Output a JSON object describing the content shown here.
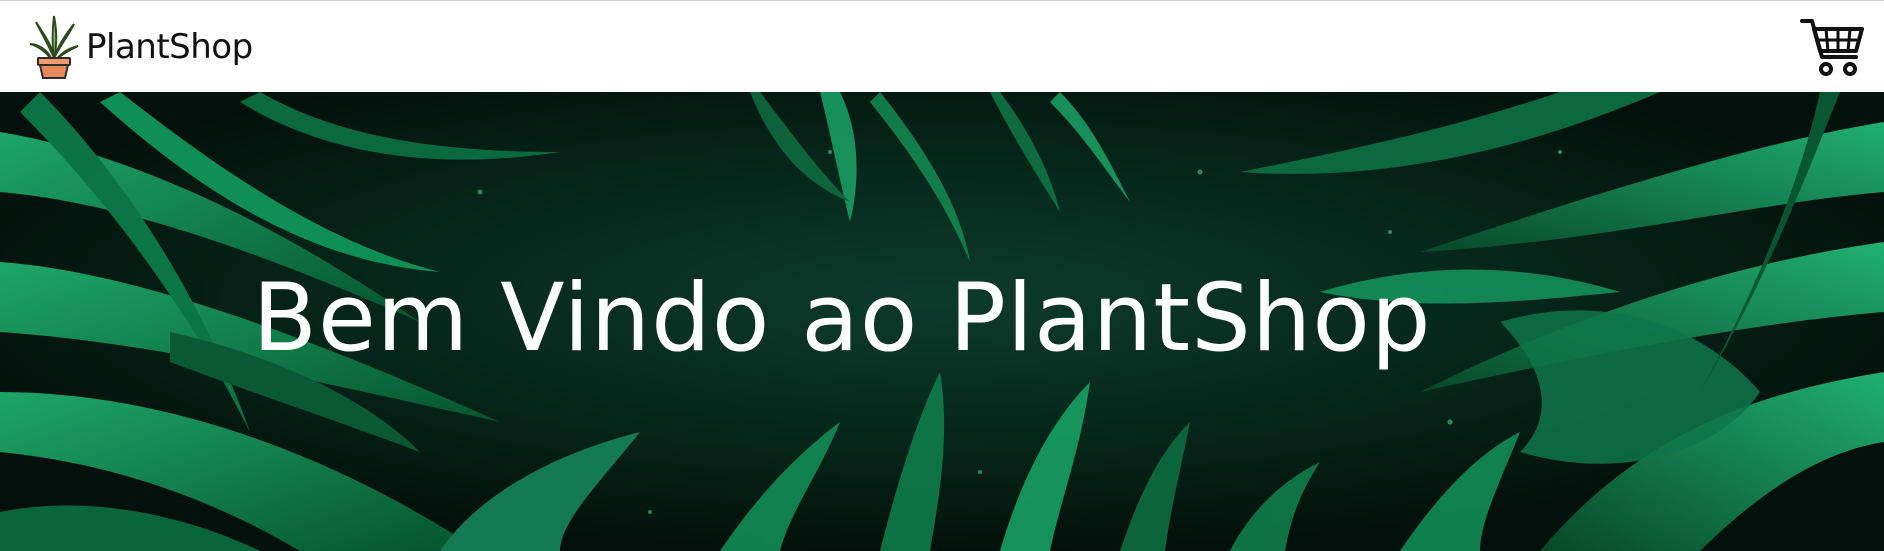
{
  "navbar": {
    "brand_name": "PlantShop",
    "brand_icon": "potted-plant-icon",
    "cart_icon": "shopping-cart-icon"
  },
  "hero": {
    "title": "Bem Vindo ao PlantShop"
  },
  "colors": {
    "navbar_bg": "#ffffff",
    "hero_dark": "#041d14",
    "leaf_green": "#0b8a55",
    "leaf_light": "#1fae6d",
    "pot": "#e8875a",
    "plant": "#7fb55e",
    "title_text": "#ffffff"
  }
}
